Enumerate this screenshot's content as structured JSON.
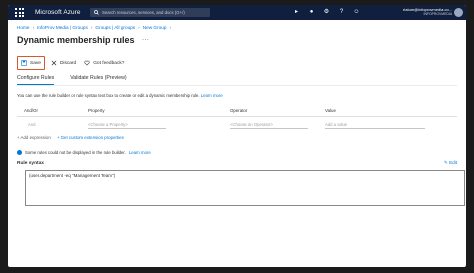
{
  "topbar": {
    "brand": "Microsoft Azure",
    "search_placeholder": "Search resources, services, and docs (G+/)",
    "user_name": "riatum@infoprovmedia.co...",
    "user_org": "INFOPROVMEDIA"
  },
  "breadcrumb": [
    "Home",
    "InfoProv Media | Groups",
    "Groups | All groups",
    "New Group"
  ],
  "page": {
    "title": "Dynamic membership rules",
    "more": "..."
  },
  "toolbar": {
    "save_label": "Save",
    "discard_label": "Discard",
    "feedback_label": "Got feedback?"
  },
  "tabs": [
    {
      "label": "Configure Rules",
      "active": true
    },
    {
      "label": "Validate Rules (Preview)",
      "active": false
    }
  ],
  "intro": {
    "text": "You can use the rule builder or rule syntax text box to create or edit a dynamic membership rule.",
    "link": "Learn more"
  },
  "rules_table": {
    "columns": [
      "And/Or",
      "Property",
      "Operator",
      "Value"
    ],
    "row": {
      "andor": "And",
      "property": "<Choose a Property>",
      "operator": "<Choose an Operator>",
      "value": "Add a value"
    }
  },
  "actions": {
    "add_expression": "+ Add expression",
    "custom_properties": "+ Get custom extension properties"
  },
  "info": {
    "text": "Some rules could not be displayed in the rule builder.",
    "link": "Learn more"
  },
  "syntax": {
    "label": "Rule syntax",
    "edit": "Edit",
    "value": "(user.department -eq \"Management Team\")"
  }
}
